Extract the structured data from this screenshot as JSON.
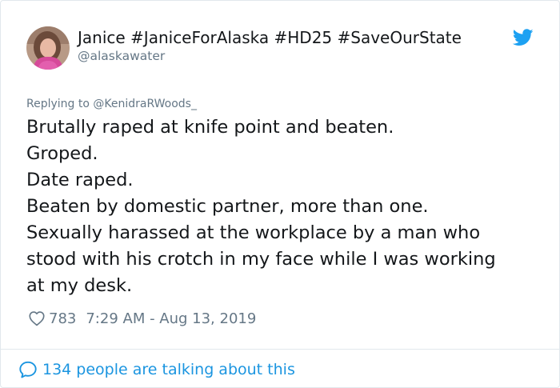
{
  "author": {
    "display_name": "Janice #JaniceForAlaska #HD25 #SaveOurState",
    "handle": "@alaskawater"
  },
  "reply": {
    "prefix": "Replying to ",
    "to_handle": "@KenidraRWoods_"
  },
  "tweet": {
    "lines": [
      "Brutally raped at knife point and beaten.",
      "Groped.",
      "Date raped.",
      "Beaten by domestic partner, more than one.",
      "Sexually harassed at the workplace by a man who",
      "stood with his crotch in my face while I was working",
      "at my desk."
    ]
  },
  "meta": {
    "like_count": "783",
    "timestamp": "7:29 AM - Aug 13, 2019"
  },
  "footer": {
    "talking_text": "134 people are talking about this"
  },
  "icons": {
    "brand": "twitter-bird-icon",
    "like": "heart-icon",
    "conversation": "speech-bubble-icon"
  },
  "colors": {
    "brand_blue": "#1da1f2",
    "link_blue": "#1b95e0",
    "secondary_text": "#657786",
    "primary_text": "#14171a",
    "border": "#e1e8ed"
  }
}
